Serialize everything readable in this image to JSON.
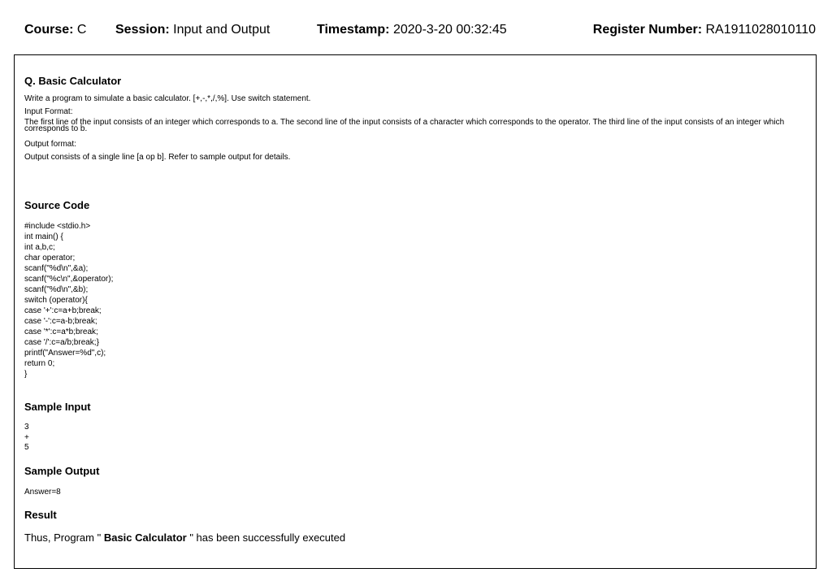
{
  "header": {
    "course_label": "Course:",
    "course_value": "C",
    "session_label": "Session:",
    "session_value": "Input and Output",
    "timestamp_label": "Timestamp:",
    "timestamp_value": "2020-3-20 00:32:45",
    "register_label": "Register Number:",
    "register_value": "RA1911028010110"
  },
  "question": {
    "title": "Q. Basic Calculator",
    "description": "Write a program to simulate a basic calculator. [+,-,*,/,%]. Use switch statement.",
    "input_format_label": "Input Format:",
    "input_format_text": "The first line of the input consists of an integer which corresponds to a. The second line of the input consists of a character which corresponds to the operator. The third line of the input consists of an integer which corresponds to b.",
    "output_format_label": "Output format:",
    "output_format_text": "Output consists of a single line [a op b]. Refer to sample output for details."
  },
  "source_code": {
    "title": "Source Code",
    "lines": [
      "#include <stdio.h>",
      "int main() {",
      "int a,b,c;",
      "char operator;",
      "scanf(\"%d\\n\",&a);",
      "scanf(\"%c\\n\",&operator);",
      "scanf(\"%d\\n\",&b);",
      "switch (operator){",
      "case '+':c=a+b;break;",
      "case '-':c=a-b;break;",
      "case '*':c=a*b;break;",
      "case '/':c=a/b;break;}",
      "printf(\"Answer=%d\",c);",
      "return 0;",
      "}"
    ]
  },
  "sample_input": {
    "title": "Sample Input",
    "lines": [
      "3",
      "+",
      "5"
    ]
  },
  "sample_output": {
    "title": "Sample Output",
    "lines": [
      "Answer=8"
    ]
  },
  "result": {
    "title": "Result",
    "prefix": "Thus, Program \"",
    "program_name": "Basic Calculator",
    "suffix": "\" has been successfully executed"
  }
}
